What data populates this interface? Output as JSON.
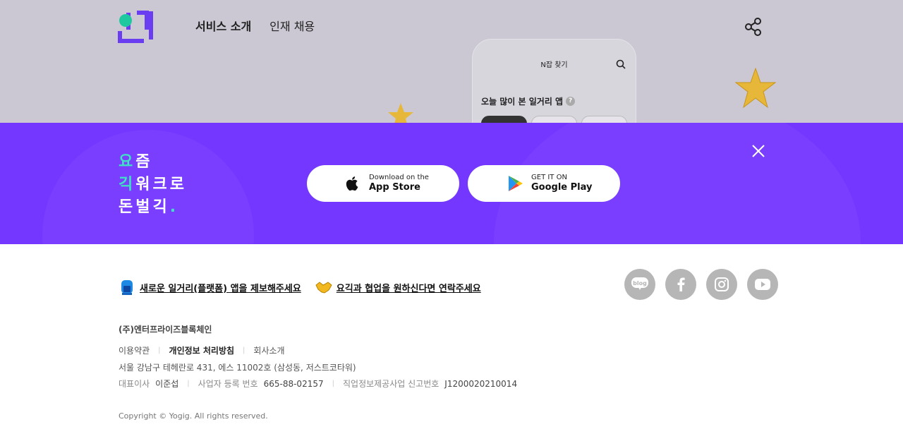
{
  "header": {
    "nav": [
      {
        "label": "서비스 소개",
        "active": true
      },
      {
        "label": "인재 채용",
        "active": false
      }
    ]
  },
  "phone_preview": {
    "title": "N잡 찾기",
    "heading": "오늘 많이 본 일거리 앱",
    "help_symbol": "?"
  },
  "banner": {
    "slogan_lines": [
      {
        "accent": "요",
        "rest": "즘"
      },
      {
        "accent": "긱",
        "rest": "워크로"
      },
      {
        "accent": "",
        "rest": "돈벌긱",
        "dot": "."
      }
    ],
    "app_store": {
      "small": "Download on the",
      "big": "App Store"
    },
    "google_play": {
      "small": "GET IT ON",
      "big": "Google Play"
    }
  },
  "footer": {
    "links": [
      {
        "label": "새로운 일거리(플랫폼) 앱을 제보해주세요",
        "icon": "mailbox-icon"
      },
      {
        "label": "요긱과 협업을 원하신다면 연락주세요",
        "icon": "handshake-icon"
      }
    ],
    "social": [
      "blog-icon",
      "facebook-icon",
      "instagram-icon",
      "youtube-icon"
    ],
    "company": "(주)엔터프라이즈블록체인",
    "legal": {
      "terms": "이용약관",
      "privacy": "개인정보 처리방침",
      "about": "회사소개"
    },
    "address": "서울 강남구 테헤란로 431, 에스 11002호 (삼성동, 저스트코타워)",
    "ceo_label": "대표이사",
    "ceo": "이준섭",
    "bizno_label": "사업자 등록 번호",
    "bizno": "665-88-02157",
    "jobinfo_label": "직업정보제공사업 신고번호",
    "jobinfo": "J1200020210014",
    "copyright": "Copyright © Yogig. All rights reserved."
  },
  "colors": {
    "brand_purple": "#7437ff",
    "mint": "#3fe0c4",
    "header_bg": "#cbc8d3"
  }
}
